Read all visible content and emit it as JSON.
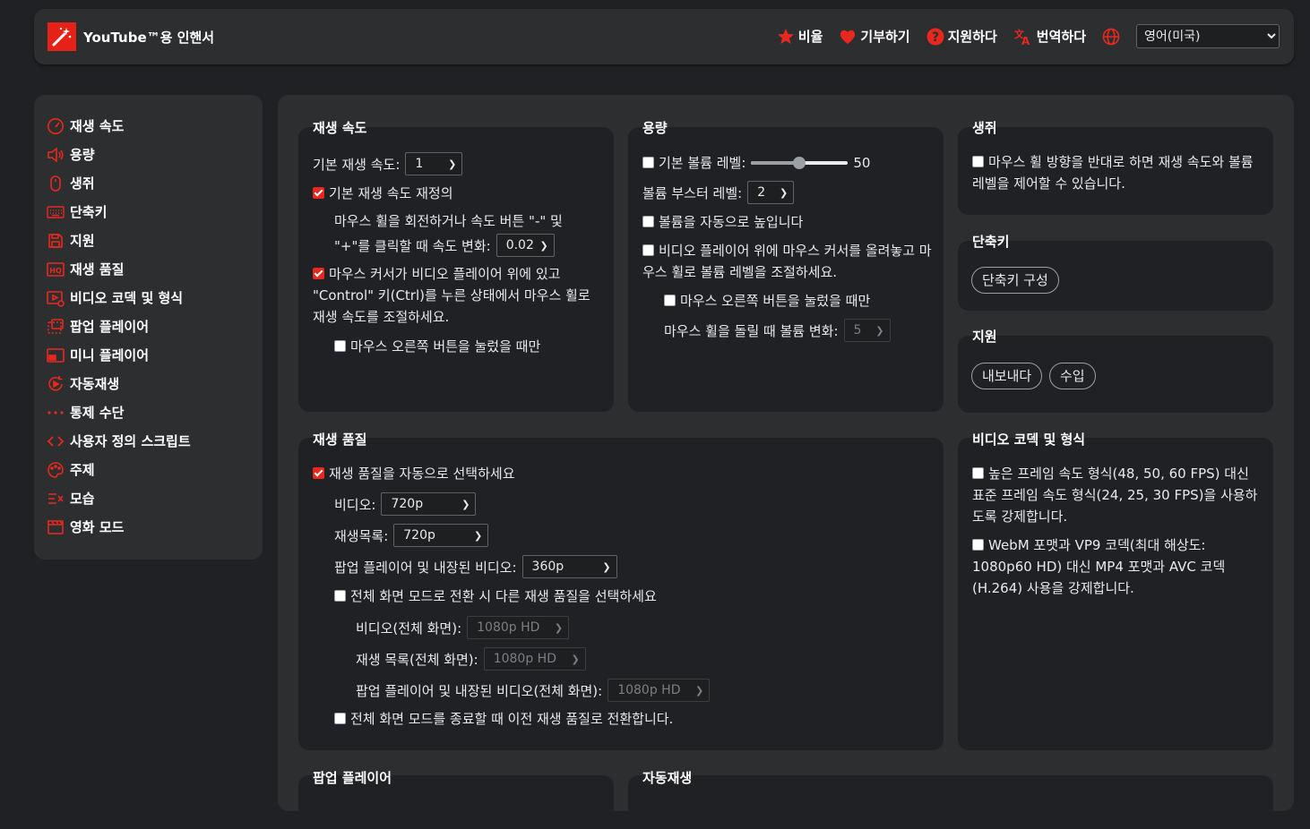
{
  "header": {
    "title": "YouTube™용 인핸서",
    "links": {
      "rate": "비율",
      "donate": "기부하기",
      "support": "지원하다",
      "translate": "번역하다"
    },
    "language": "영어(미국)"
  },
  "sidebar": {
    "items": [
      {
        "label": "재생 속도",
        "icon": "speedometer-icon"
      },
      {
        "label": "용량",
        "icon": "volume-icon"
      },
      {
        "label": "생쥐",
        "icon": "mouse-icon"
      },
      {
        "label": "단축키",
        "icon": "keyboard-icon"
      },
      {
        "label": "지원",
        "icon": "floppy-disk-icon"
      },
      {
        "label": "재생 품질",
        "icon": "hq-icon"
      },
      {
        "label": "비디오 코덱 및 형식",
        "icon": "video-codec-icon"
      },
      {
        "label": "팝업 플레이어",
        "icon": "popup-player-icon"
      },
      {
        "label": "미니 플레이어",
        "icon": "mini-player-icon"
      },
      {
        "label": "자동재생",
        "icon": "autoplay-icon"
      },
      {
        "label": "통제 수단",
        "icon": "dots-icon"
      },
      {
        "label": "사용자 정의 스크립트",
        "icon": "code-icon"
      },
      {
        "label": "주제",
        "icon": "palette-icon"
      },
      {
        "label": "모습",
        "icon": "appearance-icon"
      },
      {
        "label": "영화 모드",
        "icon": "clapperboard-icon"
      }
    ]
  },
  "speed": {
    "title": "재생 속도",
    "default_label": "기본 재생 속도:",
    "default_value": "1",
    "override_label": "기본 재생 속도 재정의",
    "step_line1": "마우스 휠을 회전하거나 속도 버튼 \"-\" 및",
    "step_line2": "\"+\"를 클릭할 때 속도 변화:",
    "step_value": "0.02",
    "ctrl_wheel": "마우스 커서가 비디오 플레이어 위에 있고 \"Control\" 키(Ctrl)를 누른 상태에서 마우스 휠로 재생 속도를 조절하세요.",
    "right_button": "마우스 오른쪽 버튼을 눌렀을 때만"
  },
  "volume": {
    "title": "용량",
    "default_label": "기본 볼륨 레벨:",
    "default_level": 50,
    "default_level_text": "50",
    "booster_label": "볼륨 부스터 레벨:",
    "booster_value": "2",
    "auto_raise": "볼륨을 자동으로 높입니다",
    "wheel_label": "비디오 플레이어 위에 마우스 커서를 올려놓고 마우스 휠로 볼륨 레벨을 조절하세요.",
    "right_button": "마우스 오른쪽 버튼을 눌렀을 때만",
    "step_label": "마우스 휠을 돌릴 때 볼륨 변화:",
    "step_value": "5"
  },
  "mouse": {
    "title": "생쥐",
    "reverse_label": "마우스 휠 방향을 반대로 하면 재생 속도와 볼륨 레벨을 제어할 수 있습니다."
  },
  "shortcuts": {
    "title": "단축키",
    "configure": "단축키 구성"
  },
  "support": {
    "title": "지원",
    "export": "내보내다",
    "import": "수입"
  },
  "quality": {
    "title": "재생 품질",
    "auto_select": "재생 품질을 자동으로 선택하세요",
    "video_label": "비디오:",
    "video_value": "720p",
    "playlist_label": "재생목록:",
    "playlist_value": "720p",
    "popup_label": "팝업 플레이어 및 내장된 비디오:",
    "popup_value": "360p",
    "fullscreen_diff": "전체 화면 모드로 전환 시 다른 재생 품질을 선택하세요",
    "fs_video_label": "비디오(전체 화면):",
    "fs_video_value": "1080p HD",
    "fs_playlist_label": "재생 목록(전체 화면):",
    "fs_playlist_value": "1080p HD",
    "fs_popup_label": "팝업 플레이어 및 내장된 비디오(전체 화면):",
    "fs_popup_value": "1080p HD",
    "exit_fullscreen": "전체 화면 모드를 종료할 때 이전 재생 품질로 전환합니다."
  },
  "codec": {
    "title": "비디오 코덱 및 형식",
    "framerate": "높은 프레임 속도 형식(48, 50, 60 FPS) 대신 표준 프레임 속도 형식(24, 25, 30 FPS)을 사용하도록 강제합니다.",
    "webm": "WebM 포맷과 VP9 코덱(최대 해상도: 1080p60 HD) 대신 MP4 포맷과 AVC 코덱(H.264) 사용을 강제합니다."
  },
  "popup_player": {
    "title": "팝업 플레이어"
  },
  "autoplay": {
    "title": "자동재생"
  },
  "colors": {
    "accent": "#e8281e",
    "background": "#202124",
    "panel": "#2d2e30"
  }
}
